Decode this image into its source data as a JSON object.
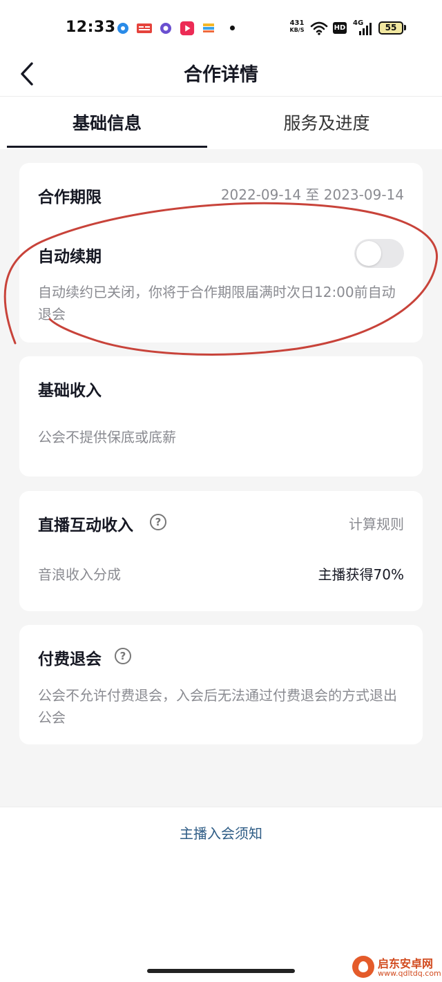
{
  "status_bar": {
    "time": "12:33",
    "network_speed": "431",
    "network_speed_unit": "KB/S",
    "hd": "HD",
    "network_type": "4G",
    "battery": "55",
    "app_icons": [
      "browser-icon",
      "toutiao-icon",
      "camera-app-icon",
      "video-app-icon",
      "wallet-app-icon"
    ]
  },
  "header": {
    "title": "合作详情"
  },
  "tabs": [
    {
      "label": "基础信息",
      "active": true
    },
    {
      "label": "服务及进度",
      "active": false
    }
  ],
  "cooperation": {
    "period_label": "合作期限",
    "period_value": "2022-09-14 至 2023-09-14",
    "auto_renew_label": "自动续期",
    "auto_renew_on": false,
    "auto_renew_desc": "自动续约已关闭，你将于合作期限届满时次日12:00前自动退会"
  },
  "basic_income": {
    "title": "基础收入",
    "desc": "公会不提供保底或底薪"
  },
  "live_income": {
    "title": "直播互动收入",
    "rule_link": "计算规则",
    "share_label": "音浪收入分成",
    "share_value": "主播获得70%"
  },
  "paid_exit": {
    "title": "付费退会",
    "desc": "公会不允许付费退会，入会后无法通过付费退会的方式退出公会"
  },
  "footer": {
    "notice_link": "主播入会须知"
  },
  "watermark": {
    "name": "启东安卓网",
    "url": "www.qdltdq.com"
  },
  "colors": {
    "text_primary": "#161823",
    "text_secondary": "#8a8b91",
    "link": "#2f5d86",
    "background": "#f5f5f5",
    "annotation": "#c8433a"
  }
}
